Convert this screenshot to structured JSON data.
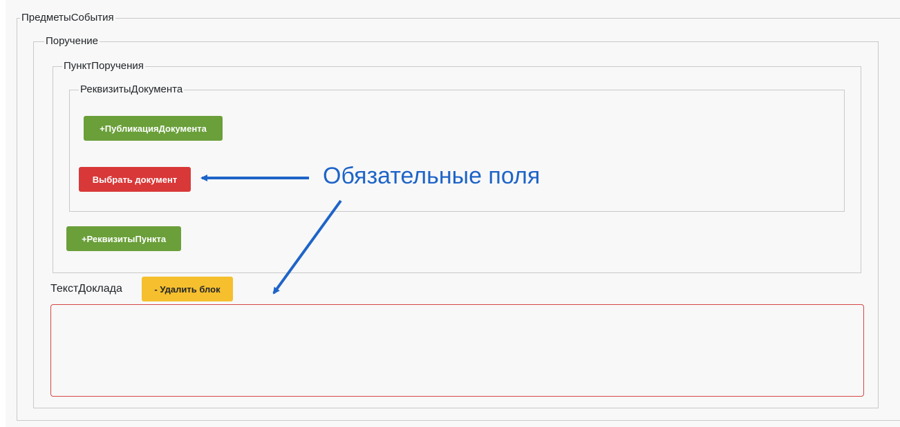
{
  "fieldsets": {
    "subjects": "ПредметыСобытия",
    "instruction": "Поручение",
    "instruction_item": "ПунктПоручения",
    "document_details": "РеквизитыДокумента"
  },
  "buttons": {
    "add_publication": "+ПубликацияДокумента",
    "select_document": "Выбрать документ",
    "add_item_details": "+РеквизитыПункта",
    "delete_block": "- Удалить блок"
  },
  "report_text": {
    "label": "ТекстДоклада",
    "value": ""
  },
  "annotation": {
    "text": "Обязательные поля",
    "color": "#1e64c8"
  },
  "colors": {
    "green": "#6a9f3a",
    "red": "#d93838",
    "yellow": "#f6bf2e",
    "required_border": "#d64545"
  }
}
